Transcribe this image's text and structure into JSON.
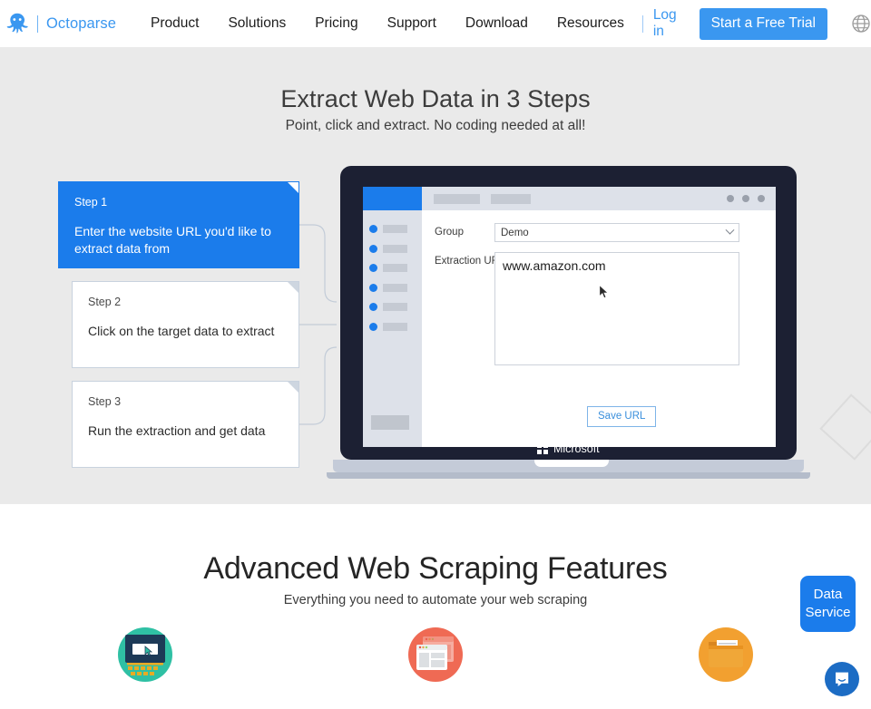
{
  "nav": {
    "brand": "Octoparse",
    "logo_icon": "octopus-icon",
    "links": [
      "Product",
      "Solutions",
      "Pricing",
      "Support",
      "Download",
      "Resources"
    ],
    "login_label": "Log in",
    "trial_label": "Start a Free Trial",
    "language_icon": "globe-icon",
    "accent_color": "#3a97f0"
  },
  "hero": {
    "title": "Extract Web Data in 3 Steps",
    "subtitle": "Point, click and extract. No coding needed at all!",
    "background_color": "#eaeaea",
    "steps": [
      {
        "label": "Step 1",
        "text": "Enter the website URL you'd like to extract data from",
        "active": true
      },
      {
        "label": "Step 2",
        "text": "Click on the target data to extract",
        "active": false
      },
      {
        "label": "Step 3",
        "text": "Run the extraction and get data",
        "active": false
      }
    ],
    "app": {
      "group_label": "Group",
      "group_value": "Demo",
      "url_label": "Extraction URL",
      "url_value": "www.amazon.com",
      "save_label": "Save URL",
      "sidebar_item_count": 6,
      "window_dot_count": 3,
      "tab_placeholder_count": 2,
      "brand_label": "Microsoft",
      "brand_icon": "microsoft-logo-icon",
      "cursor_icon": "mouse-cursor-icon",
      "accent_color": "#1b7ceb"
    }
  },
  "features": {
    "title": "Advanced Web Scraping Features",
    "subtitle": "Everything you need to automate your web scraping",
    "items": [
      {
        "icon": "point-and-click-icon",
        "circle_color": "#2fc0a4"
      },
      {
        "icon": "multiple-browsers-icon",
        "circle_color": "#ef6a54"
      },
      {
        "icon": "data-folder-icon",
        "circle_color": "#f2a030"
      }
    ]
  },
  "widgets": {
    "data_service_line1": "Data",
    "data_service_line2": "Service",
    "data_service_color": "#1b7ceb",
    "chat_icon": "chat-bubble-icon",
    "chat_color": "#1c6cc4"
  }
}
